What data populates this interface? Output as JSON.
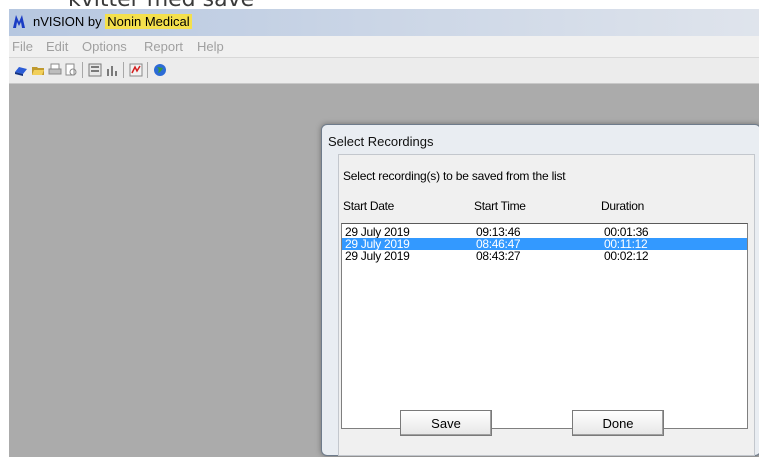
{
  "caption": "kvitter med save",
  "window": {
    "title_prefix": "nVISION by",
    "title_highlight": "Nonin Medical"
  },
  "menu": [
    "File",
    "Edit",
    "Options",
    "Report",
    "Help"
  ],
  "toolbar_icons": [
    "open-folder-icon",
    "open-file-icon",
    "print-icon",
    "print-preview-icon",
    "report-icon",
    "chart-icon",
    "recording-icon",
    "globe-icon"
  ],
  "dialog": {
    "title": "Select Recordings",
    "prompt": "Select recording(s) to be saved from the list",
    "columns": [
      "Start Date",
      "Start Time",
      "Duration"
    ],
    "rows": [
      {
        "date": "29 July 2019",
        "time": "09:13:46",
        "duration": "00:01:36",
        "selected": false
      },
      {
        "date": "29 July 2019",
        "time": "08:46:47",
        "duration": "00:11:12",
        "selected": true
      },
      {
        "date": "29 July 2019",
        "time": "08:43:27",
        "duration": "00:02:12",
        "selected": false
      }
    ],
    "save_label": "Save",
    "done_label": "Done"
  },
  "colors": {
    "selection": "#3399ff",
    "workspace": "#ababab",
    "title_highlight": "#f4e04d"
  }
}
